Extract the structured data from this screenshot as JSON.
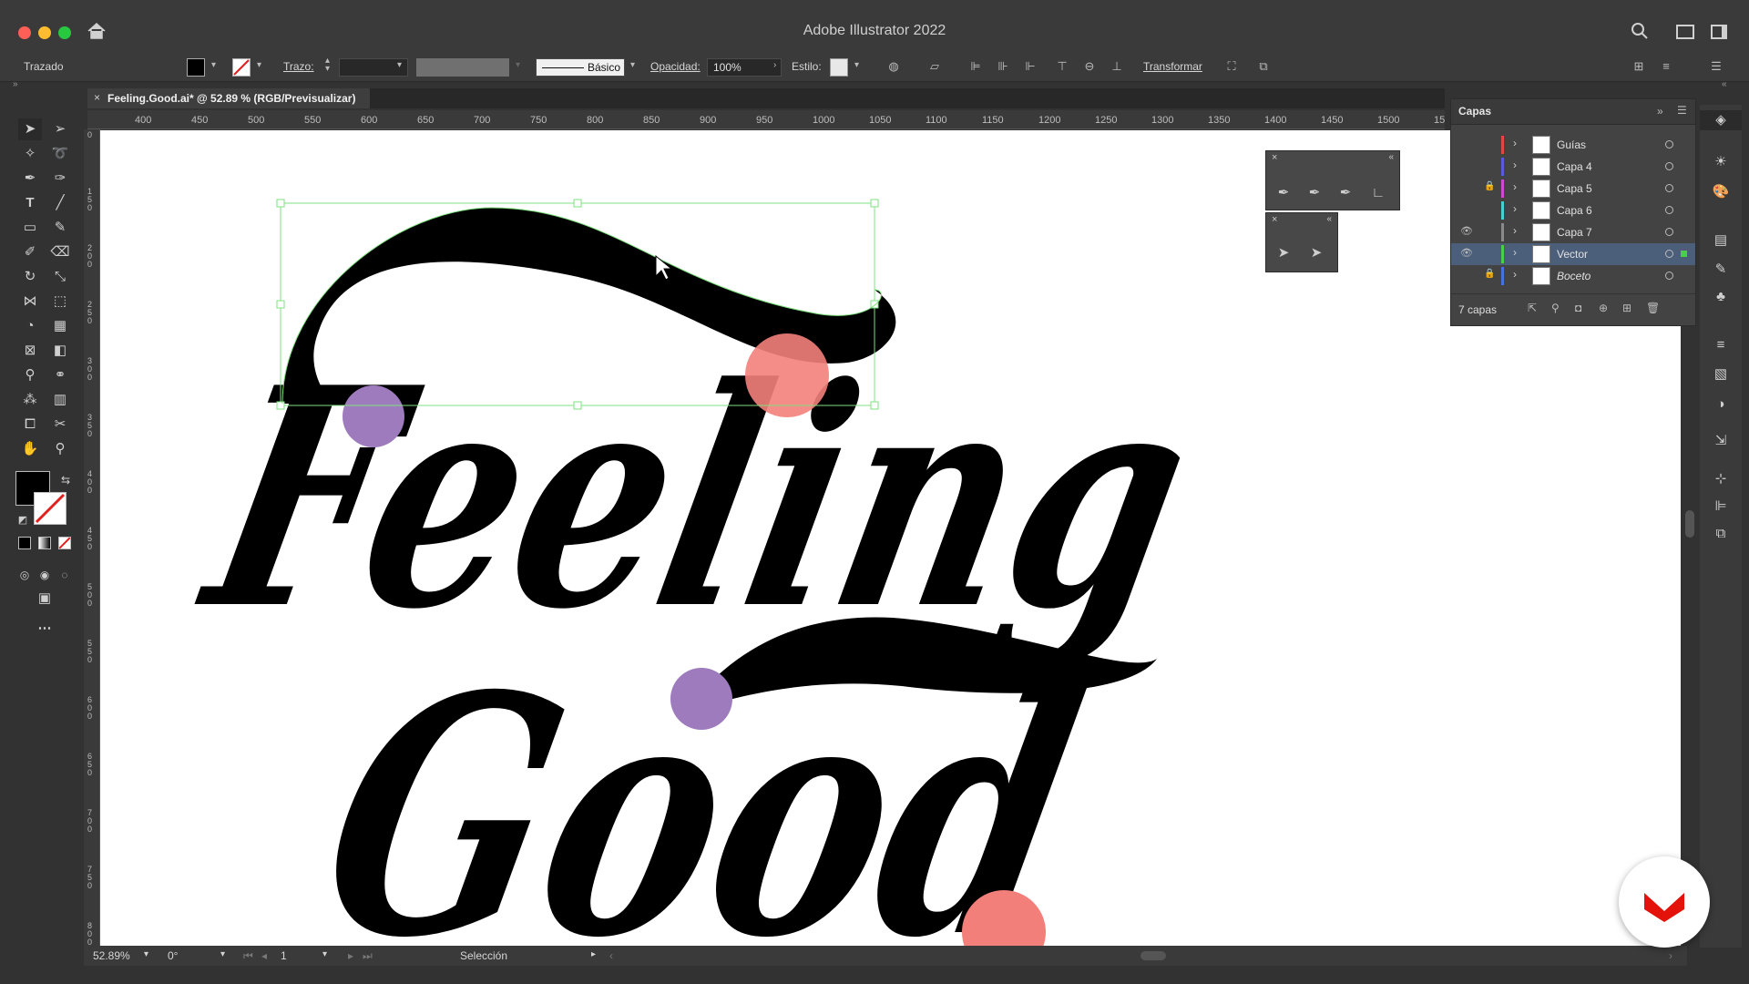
{
  "window": {
    "title": "Adobe Illustrator 2022"
  },
  "control_bar": {
    "selection_type": "Trazado",
    "stroke_label": "Trazo:",
    "brush_label": "Básico",
    "opacity_label": "Opacidad:",
    "opacity_value": "100%",
    "style_label": "Estilo:",
    "transform_label": "Transformar"
  },
  "document_tab": {
    "title": "Feeling.Good.ai* @ 52.89 % (RGB/Previsualizar)"
  },
  "ruler": {
    "h_ticks": [
      "400",
      "450",
      "500",
      "550",
      "600",
      "650",
      "700",
      "750",
      "800",
      "850",
      "900",
      "950",
      "1000",
      "1050",
      "1100",
      "1150",
      "1200",
      "1250",
      "1300",
      "1350",
      "1400",
      "1450",
      "1500",
      "15"
    ],
    "v_ticks": [
      "0",
      "150",
      "200",
      "250",
      "300",
      "350",
      "400",
      "450",
      "500",
      "550",
      "600",
      "650",
      "700",
      "750",
      "800"
    ]
  },
  "artwork": {
    "line1": "Feeling",
    "line2": "Good",
    "colors": {
      "ink": "#000000",
      "purple": "#9d7bbd",
      "salmon": "#f37f7a",
      "selection": "#7fe07f"
    }
  },
  "layers_panel": {
    "title": "Capas",
    "layers": [
      {
        "name": "Guías",
        "color": "#e04848",
        "visible": false,
        "locked": false
      },
      {
        "name": "Capa 4",
        "color": "#5a5ae0",
        "visible": false,
        "locked": false
      },
      {
        "name": "Capa 5",
        "color": "#d048d0",
        "visible": false,
        "locked": true
      },
      {
        "name": "Capa 6",
        "color": "#48d0d0",
        "visible": false,
        "locked": false
      },
      {
        "name": "Capa 7",
        "color": "#8a8a8a",
        "visible": true,
        "locked": false
      },
      {
        "name": "Vector",
        "color": "#48d048",
        "visible": true,
        "locked": false,
        "selected": true
      },
      {
        "name": "Boceto",
        "color": "#4870e0",
        "visible": false,
        "locked": true
      }
    ],
    "count_label": "7 capas"
  },
  "status_bar": {
    "zoom": "52.89%",
    "rotation": "0°",
    "artboard": "1",
    "tool": "Selección"
  }
}
